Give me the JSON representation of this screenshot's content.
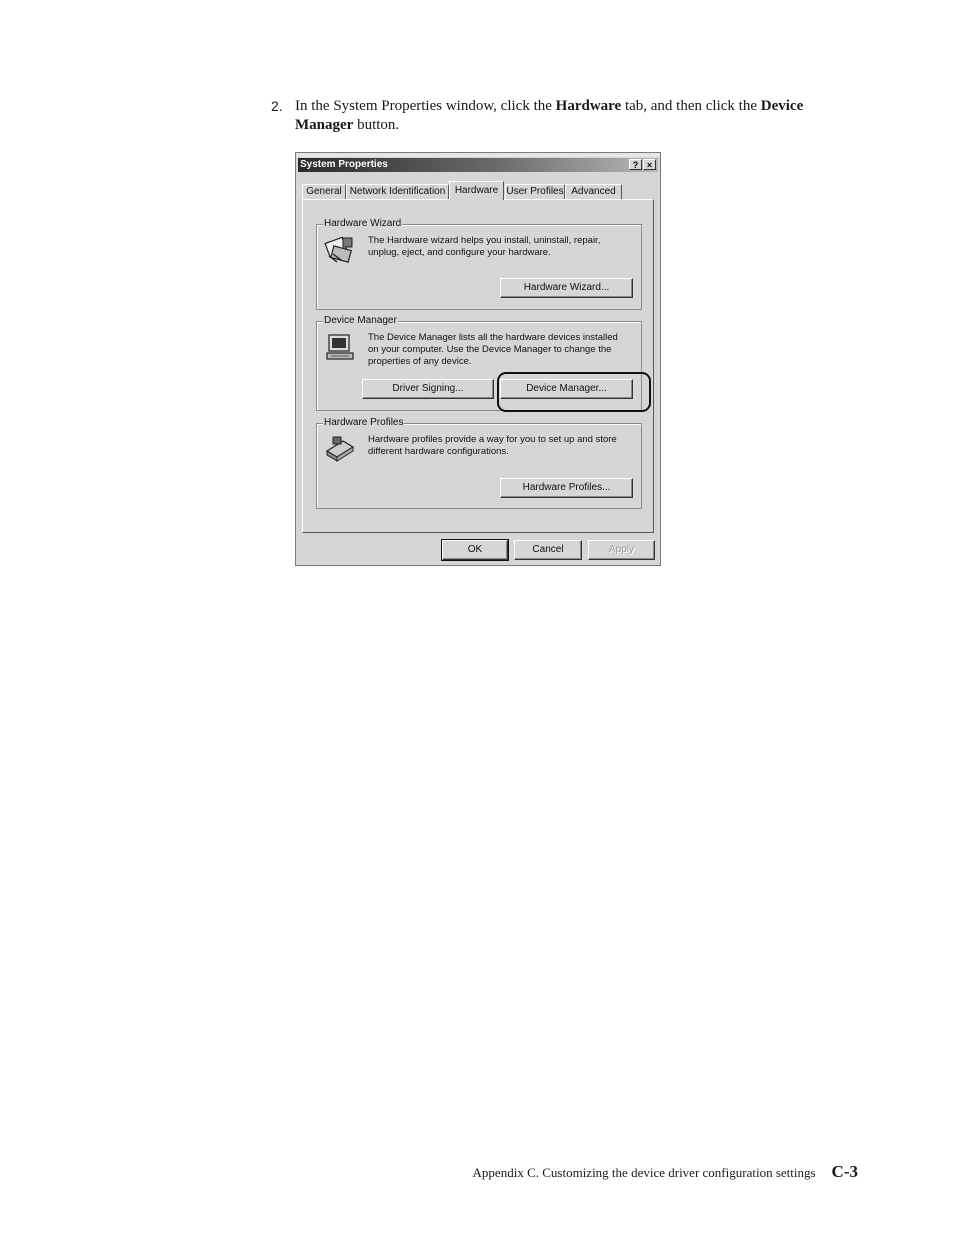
{
  "step": {
    "number": "2.",
    "text_before": "In the System Properties window, click the ",
    "bold1": "Hardware",
    "text_mid": " tab, and then click the ",
    "bold2": "Device Manager",
    "text_after": " button."
  },
  "dialog": {
    "title": "System Properties",
    "help_button": "?",
    "close_button": "×",
    "tabs": [
      "General",
      "Network Identification",
      "Hardware",
      "User Profiles",
      "Advanced"
    ],
    "active_tab": "Hardware",
    "groups": {
      "hardware_wizard": {
        "label": "Hardware Wizard",
        "text": "The Hardware wizard helps you install, uninstall, repair, unplug, eject, and configure your hardware.",
        "button": "Hardware Wizard..."
      },
      "device_manager": {
        "label": "Device Manager",
        "text": "The Device Manager lists all the hardware devices installed on your computer. Use the Device Manager to change the properties of any device.",
        "button_driver": "Driver Signing...",
        "button_dm": "Device Manager..."
      },
      "hardware_profiles": {
        "label": "Hardware Profiles",
        "text": "Hardware profiles provide a way for you to set up and store different hardware configurations.",
        "button": "Hardware Profiles..."
      }
    },
    "footer_buttons": {
      "ok": "OK",
      "cancel": "Cancel",
      "apply": "Apply"
    },
    "icons": [
      "hardware-wizard-icon",
      "computer-icon",
      "hardware-profiles-icon"
    ]
  },
  "footer": {
    "text": "Appendix C. Customizing the device driver configuration settings",
    "page": "C-3"
  }
}
